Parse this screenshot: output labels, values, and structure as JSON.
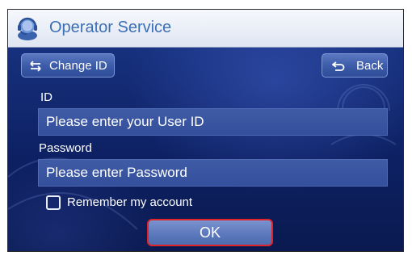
{
  "window": {
    "title": "Operator Service"
  },
  "toolbar": {
    "change_id_label": "Change ID",
    "back_label": "Back"
  },
  "form": {
    "id_label": "ID",
    "id_placeholder": "Please enter your  User ID",
    "password_label": "Password",
    "password_placeholder": "Please enter Password",
    "remember_label": "Remember my account",
    "remember_checked": false,
    "ok_label": "OK"
  },
  "icons": {
    "title": "operator-headset-icon",
    "change_id": "swap-arrows-icon",
    "back": "return-arrow-icon"
  },
  "colors": {
    "title_text": "#3d6fb5",
    "screen_bg": "#0d2062",
    "button": "#3b5aa7",
    "ok_focus_border": "#e0242a"
  }
}
